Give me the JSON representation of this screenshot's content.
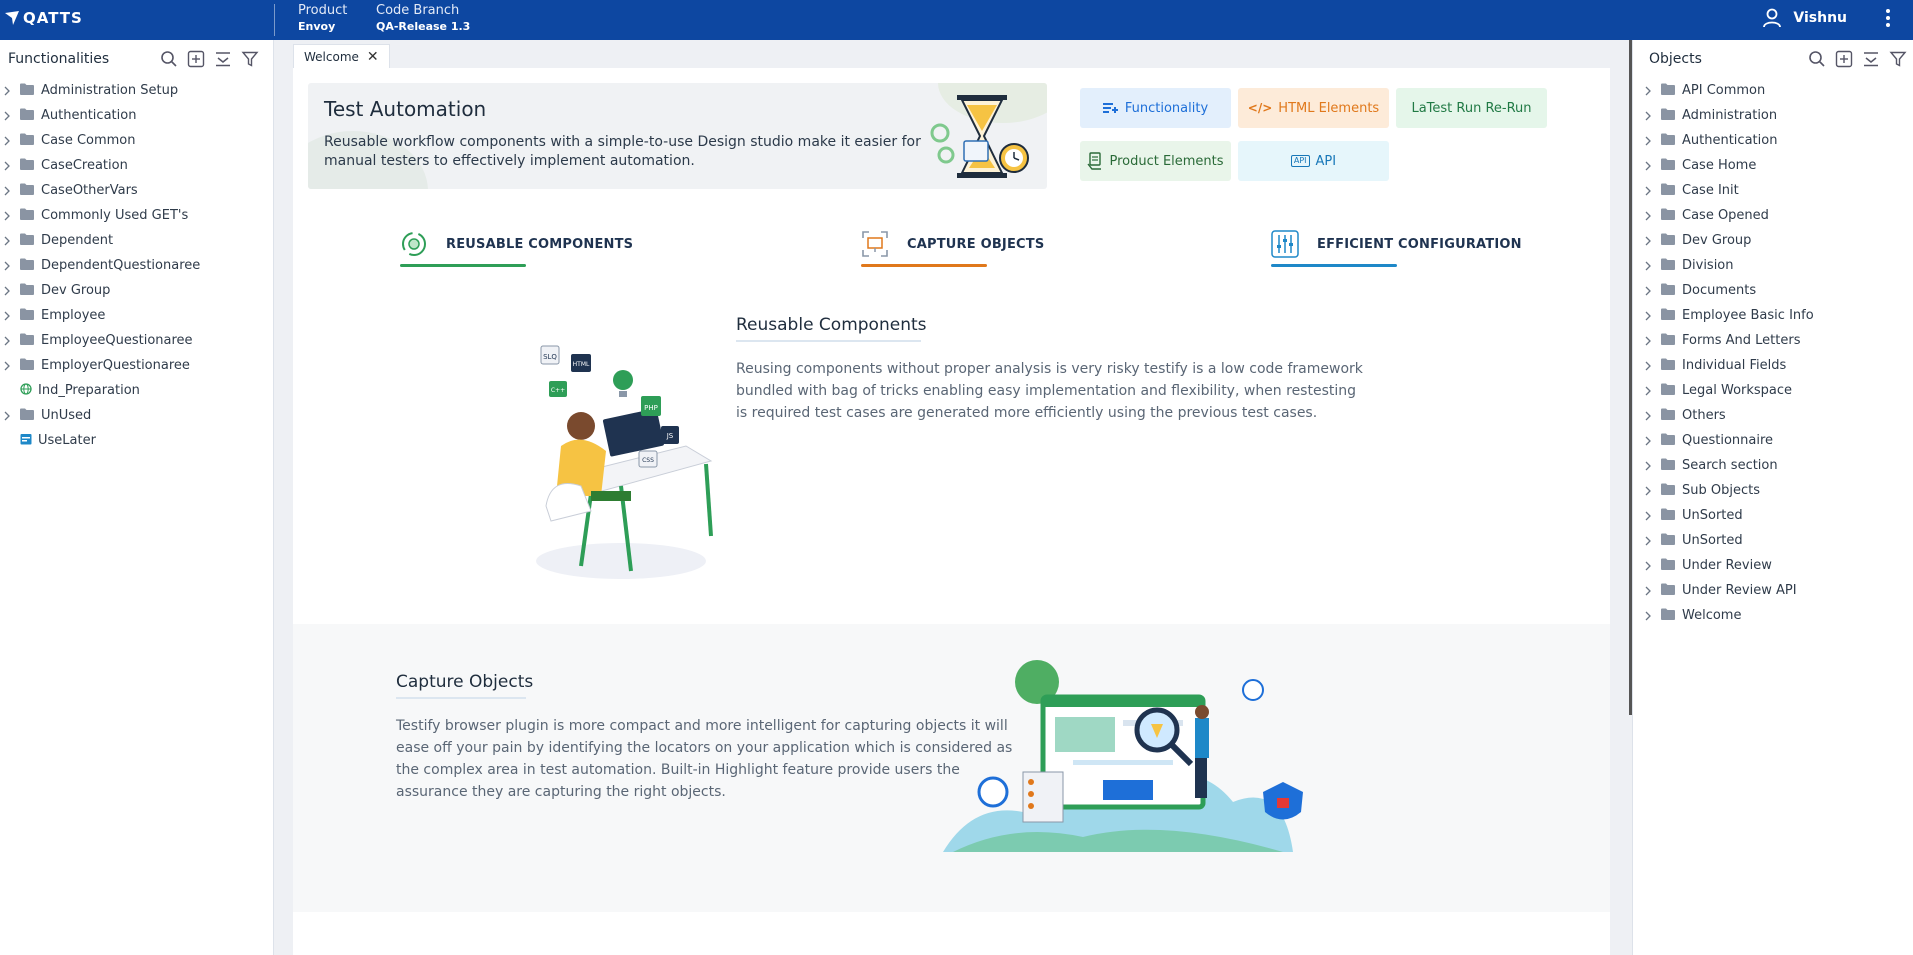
{
  "topbar": {
    "brand": "QATTS",
    "product_label": "Product",
    "product_value": "Envoy",
    "branch_label": "Code Branch",
    "branch_value": "QA-Release 1.3",
    "user_name": "Vishnu"
  },
  "left_panel": {
    "title": "Functionalities",
    "items": [
      {
        "label": "Administration Setup",
        "type": "folder"
      },
      {
        "label": "Authentication",
        "type": "folder"
      },
      {
        "label": "Case Common",
        "type": "folder"
      },
      {
        "label": "CaseCreation",
        "type": "folder"
      },
      {
        "label": "CaseOtherVars",
        "type": "folder"
      },
      {
        "label": "Commonly Used GET's",
        "type": "folder"
      },
      {
        "label": "Dependent",
        "type": "folder"
      },
      {
        "label": "DependentQuestionaree",
        "type": "folder"
      },
      {
        "label": "Dev Group",
        "type": "folder"
      },
      {
        "label": "Employee",
        "type": "folder"
      },
      {
        "label": "EmployeeQuestionaree",
        "type": "folder"
      },
      {
        "label": "EmployerQuestionaree",
        "type": "folder"
      },
      {
        "label": "Ind_Preparation",
        "type": "globe"
      },
      {
        "label": "UnUsed",
        "type": "folder"
      },
      {
        "label": "UseLater",
        "type": "calendar"
      }
    ]
  },
  "right_panel": {
    "title": "Objects",
    "items": [
      "API Common",
      "Administration",
      "Authentication",
      "Case Home",
      "Case Init",
      "Case Opened",
      "Dev Group",
      "Division",
      "Documents",
      "Employee Basic Info",
      "Forms And Letters",
      "Individual Fields",
      "Legal Workspace",
      "Others",
      "Questionnaire",
      "Search section",
      "Sub Objects",
      "UnSorted",
      "UnSorted",
      "Under Review",
      "Under Review API",
      "Welcome"
    ]
  },
  "tabs": [
    {
      "label": "Welcome"
    }
  ],
  "hero": {
    "title": "Test Automation",
    "description": "Reusable workflow components with a simple-to-use Design studio make it easier for manual testers to effectively implement automation."
  },
  "quick_buttons": {
    "functionality": "Functionality",
    "html_elements": "HTML Elements",
    "latest_rerun": "LaTest Run Re-Run",
    "product_elements": "Product Elements",
    "api": "API"
  },
  "features": {
    "reusable": "REUSABLE COMPONENTS",
    "capture": "CAPTURE OBJECTS",
    "config": "EFFICIENT CONFIGURATION"
  },
  "sections": {
    "reusable_title": "Reusable Components",
    "reusable_text": "Reusing components without proper analysis is very risky testify is a low code framework bundled with bag of tricks enabling easy implementation and flexibility, when restesting is required test cases are generated more efficiently using the previous test cases.",
    "capture_title": "Capture Objects",
    "capture_text": "Testify browser plugin is more compact and more intelligent for capturing objects it will ease off your pain by identifying the locators on your application which is considered as the complex area in test automation. Built-in Highlight feature provide users the assurance they are capturing the right objects."
  },
  "illustration_labels": {
    "slq": "SLQ",
    "html": "HTML",
    "cpp": "C++",
    "php": "PHP",
    "js": "JS",
    "css": "CSS",
    "api_badge": "API"
  },
  "colors": {
    "brand": "#0d47a1",
    "green_accent": "#2e9e57",
    "orange_accent": "#e0781b",
    "blue_accent": "#1e88c8"
  }
}
